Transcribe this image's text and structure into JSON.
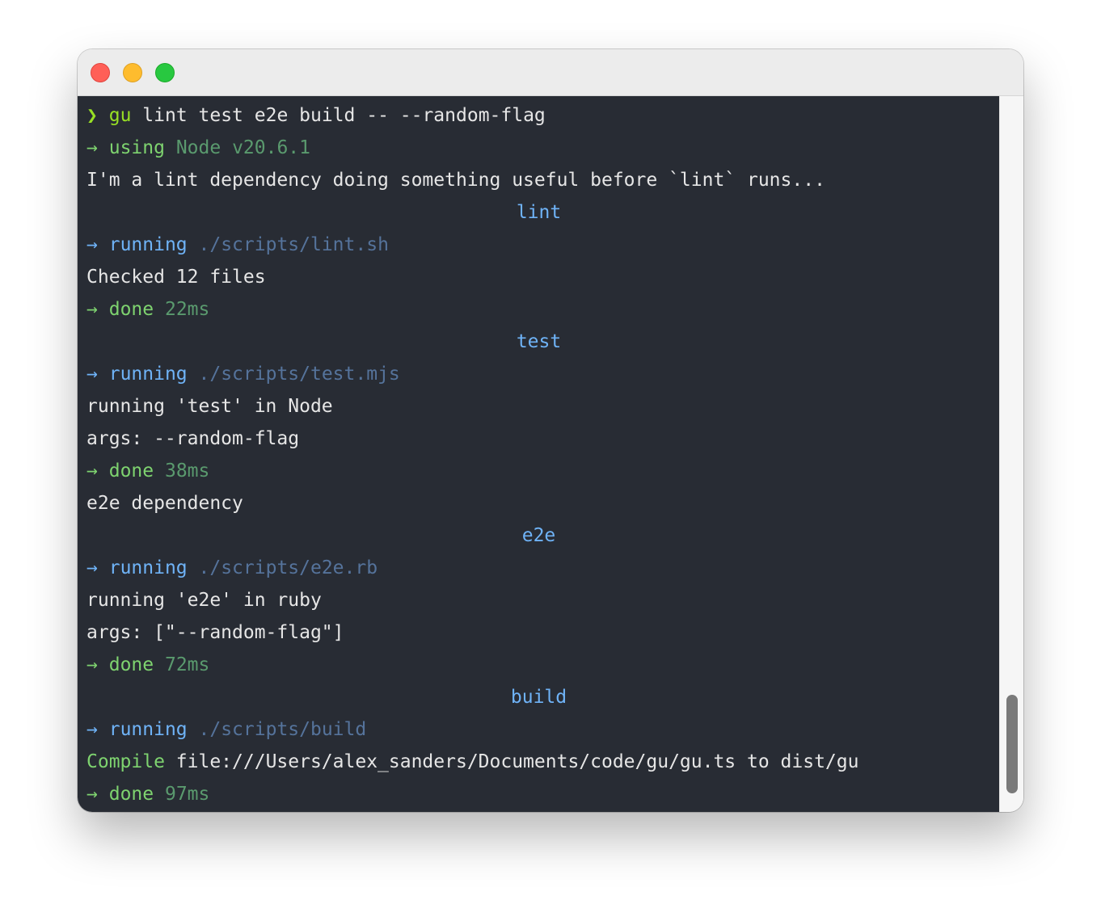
{
  "window": {
    "controls": [
      "close",
      "minimize",
      "maximize"
    ]
  },
  "terminal": {
    "prompt_symbol": "❯",
    "command": {
      "program": "gu",
      "args": "lint test e2e build -- --random-flag"
    },
    "node_line": {
      "arrow": "→",
      "verb": "using",
      "detail": "Node v20.6.1"
    },
    "lint_dependency_text": "I'm a lint dependency doing something useful before `lint` runs...",
    "sections": {
      "lint": {
        "label": "lint",
        "running_verb": "running",
        "script": "./scripts/lint.sh",
        "output": [
          "Checked 12 files"
        ],
        "done_verb": "done",
        "duration": "22ms"
      },
      "test": {
        "label": "test",
        "running_verb": "running",
        "script": "./scripts/test.mjs",
        "output": [
          "running 'test' in Node",
          "args: --random-flag"
        ],
        "done_verb": "done",
        "duration": "38ms"
      },
      "e2e_dependency_text": "e2e dependency",
      "e2e": {
        "label": "e2e",
        "running_verb": "running",
        "script": "./scripts/e2e.rb",
        "output": [
          "running 'e2e' in ruby",
          "args: [\"--random-flag\"]"
        ],
        "done_verb": "done",
        "duration": "72ms"
      },
      "build": {
        "label": "build",
        "running_verb": "running",
        "script": "./scripts/build",
        "compile_word": "Compile",
        "compile_detail": "file:///Users/alex_sanders/Documents/code/gu/gu.ts to dist/gu",
        "done_verb": "done",
        "duration": "97ms"
      }
    },
    "arrow": "→"
  },
  "colors": {
    "terminal_bg": "#282c34",
    "prompt": "#98e024",
    "green": "#7ed36f",
    "blue": "#6fb3f7",
    "text": "#e6e6e6"
  }
}
